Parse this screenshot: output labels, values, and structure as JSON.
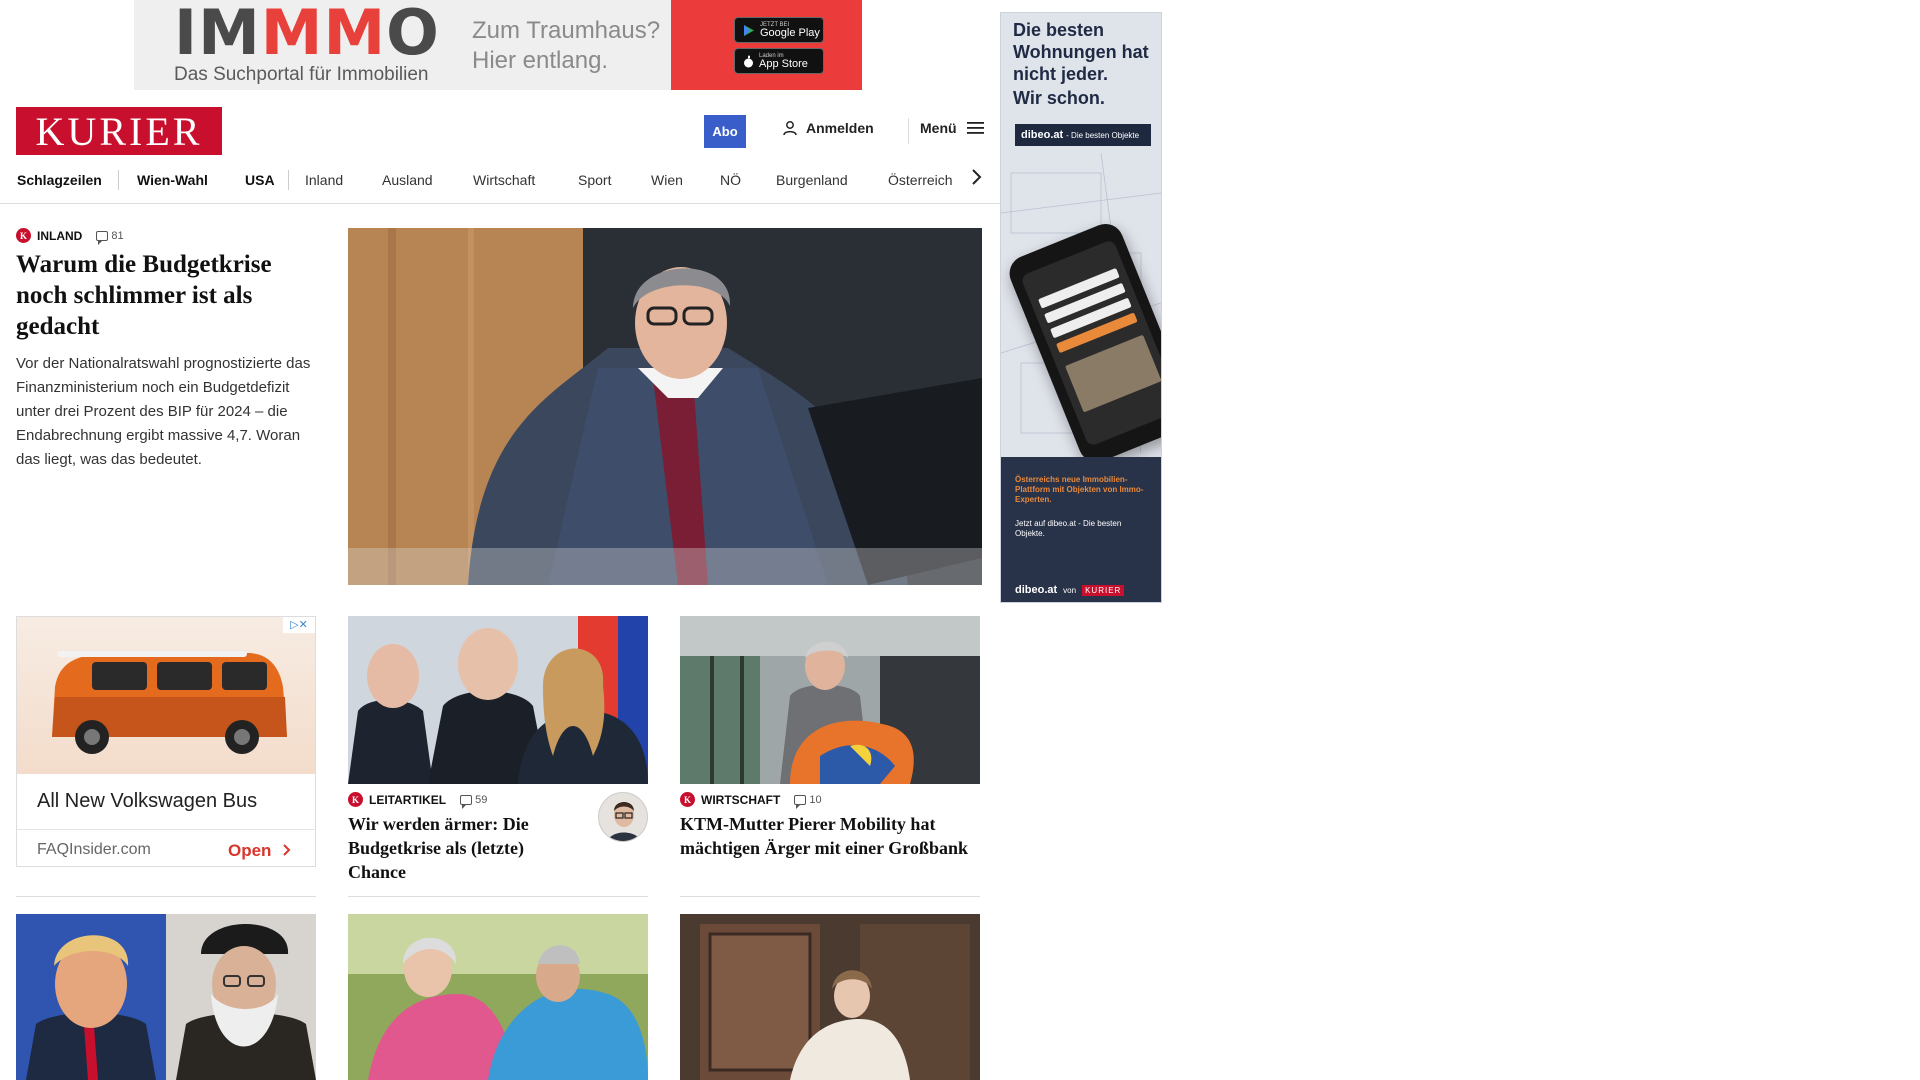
{
  "top_ad": {
    "logo_a": "I",
    "logo_mm": "MM",
    "logo_b": "O",
    "logo_first": "IM",
    "logo_last": "O",
    "tagline": "Das Suchportal für Immobilien",
    "slogan_line1": "Zum Traumhaus?",
    "slogan_line2": "Hier entlang.",
    "google_small": "JETZT BEI",
    "google_big": "Google Play",
    "apple_small": "Laden im",
    "apple_big": "App Store"
  },
  "header": {
    "brand": "KURIER",
    "abo_label": "Abo",
    "login_label": "Anmelden",
    "menu_label": "Menü"
  },
  "nav": {
    "items": [
      "Schlagzeilen",
      "Wien-Wahl",
      "USA",
      "Inland",
      "Ausland",
      "Wirtschaft",
      "Sport",
      "Wien",
      "NÖ",
      "Burgenland",
      "Österreich"
    ]
  },
  "lead": {
    "category": "INLAND",
    "comments": "81",
    "title": "Warum die Budgetkrise noch schlimmer ist als gedacht",
    "teaser": "Vor der Nationalratswahl prognostizierte das Finanzministerium noch ein Budgetdefizit unter drei Prozent des BIP für 2024 – die Endabrechnung ergibt massive 4,7. Woran das liegt, was das bedeutet."
  },
  "ad_card": {
    "title": "All New Volkswagen Bus",
    "source": "FAQInsider.com",
    "cta": "Open"
  },
  "cards": [
    {
      "category": "LEITARTIKEL",
      "comments": "59",
      "title": "Wir werden ärmer: Die Budgetkrise als (letzte) Chance"
    },
    {
      "category": "WIRTSCHAFT",
      "comments": "10",
      "title": "KTM-Mutter Pierer Mobility hat mächtigen Ärger mit einer Großbank"
    }
  ],
  "side_ad": {
    "headline1": "Die besten Wohnungen hat nicht jeder.",
    "headline2": "Wir schon.",
    "bar_brand": "dibeo.at",
    "bar_text": "- Die besten Objekte",
    "desc": "Österreichs neue Immobilien-Plattform mit Objekten von Immo-Experten.",
    "cta": "Jetzt auf dibeo.at - Die besten Objekte.",
    "footer_brand": "dibeo.at",
    "footer_von": "von",
    "footer_kurier": "KURIER"
  },
  "colors": {
    "brand_red": "#c8102e",
    "abo_blue": "#3a5ec9",
    "ad_red": "#ec3b3b"
  }
}
